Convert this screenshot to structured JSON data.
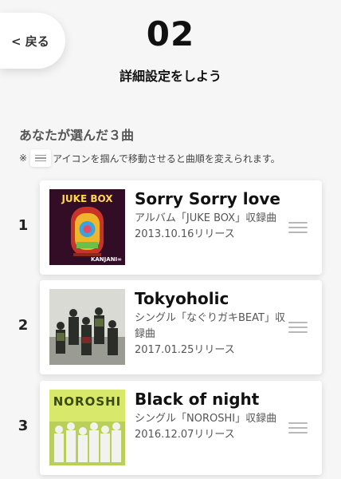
{
  "header": {
    "back_label": "< 戻る",
    "step": "02",
    "subtitle": "詳細設定をしよう"
  },
  "section": {
    "title": "あなたが選んだ３曲",
    "note_prefix": "※",
    "note_text": "アイコンを掴んで移動させると曲順を変えられます。"
  },
  "songs": [
    {
      "num": "1",
      "title": "Sorry Sorry love",
      "desc": "アルバム「JUKE BOX」収録曲",
      "date": "2013.10.16リリース",
      "cover_text": "JUKE BOX",
      "cover_sub": "KANJANI∞"
    },
    {
      "num": "2",
      "title": "Tokyoholic",
      "desc": "シングル「なぐりガキBEAT」収録曲",
      "date": "2017.01.25リリース"
    },
    {
      "num": "3",
      "title": "Black of night",
      "desc": "シングル「NOROSHI」収録曲",
      "date": "2016.12.07リリース",
      "cover_text": "NOROSHI"
    }
  ],
  "colors": {
    "background": "#f6f6f6",
    "card": "#ffffff",
    "handle": "#b8b8b8"
  }
}
